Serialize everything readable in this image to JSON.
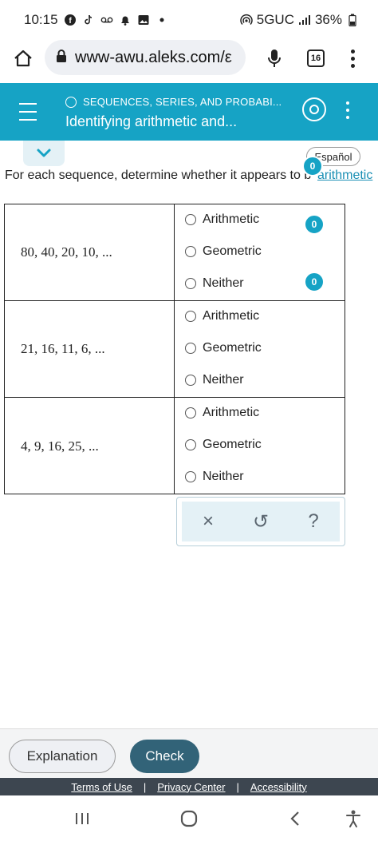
{
  "status_bar": {
    "time": "10:15",
    "network": "5GUC",
    "battery": "36%",
    "icons": [
      "facebook-icon",
      "tiktok-icon",
      "voicemail-icon",
      "alarm-icon",
      "gallery-icon",
      "dot-icon"
    ]
  },
  "browser": {
    "url": "www-awu.aleks.com/ε",
    "tab_count": "16"
  },
  "app_header": {
    "topic": "SEQUENCES, SERIES, AND PROBABI...",
    "title": "Identifying arithmetic and..."
  },
  "espanol_label": "Español",
  "instructions": "For each sequence, determine whether it appears to b",
  "instructions_link": "arithmetic",
  "annotation_badge": "0",
  "questions": [
    {
      "sequence": "80, 40, 20, 10, ...",
      "options": [
        "Arithmetic",
        "Geometric",
        "Neither"
      ]
    },
    {
      "sequence": "21, 16, 11, 6, ...",
      "options": [
        "Arithmetic",
        "Geometric",
        "Neither"
      ]
    },
    {
      "sequence": "4, 9, 16, 25, ...",
      "options": [
        "Arithmetic",
        "Geometric",
        "Neither"
      ]
    }
  ],
  "tools": {
    "clear": "×",
    "undo": "↺",
    "help": "?"
  },
  "actions": {
    "explanation": "Explanation",
    "check": "Check"
  },
  "footer": {
    "terms": "Terms of Use",
    "privacy": "Privacy Center",
    "accessibility": "Accessibility"
  },
  "colors": {
    "teal": "#16a3c5",
    "check_button": "#326378",
    "footer": "#3d4650",
    "link": "#1a8fb4"
  }
}
